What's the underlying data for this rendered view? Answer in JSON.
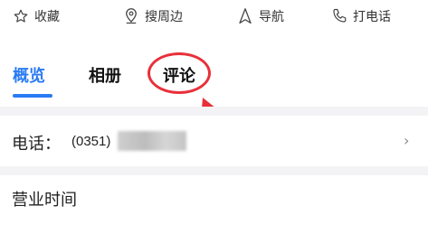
{
  "actions": [
    {
      "label": "收藏",
      "icon": "star-outline-icon"
    },
    {
      "label": "搜周边",
      "icon": "location-pin-icon"
    },
    {
      "label": "导航",
      "icon": "navigation-arrow-icon"
    },
    {
      "label": "打电话",
      "icon": "phone-icon"
    }
  ],
  "tabs": [
    {
      "label": "概览",
      "active": true
    },
    {
      "label": "相册",
      "active": false
    },
    {
      "label": "评论",
      "active": false
    }
  ],
  "phone": {
    "label": "电话：",
    "number_visible": "(0351)",
    "chevron": "›"
  },
  "hours": {
    "label": "营业时间"
  },
  "colors": {
    "accent": "#2b7bf3",
    "annotation": "#e8303a"
  }
}
